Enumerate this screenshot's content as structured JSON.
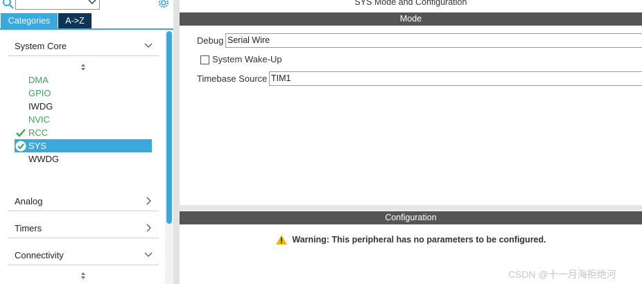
{
  "window": {
    "title": "SYS Mode and Configuration"
  },
  "left_panel": {
    "tabs": [
      {
        "label": "Categories",
        "active": true
      },
      {
        "label": "A->Z",
        "active": false
      }
    ],
    "categories": [
      {
        "label": "System Core",
        "expanded": true
      },
      {
        "label": "Analog",
        "expanded": false
      },
      {
        "label": "Timers",
        "expanded": false
      },
      {
        "label": "Connectivity",
        "expanded": true
      }
    ],
    "peripherals": [
      {
        "name": "DMA",
        "color": "#3aa655",
        "status": "none"
      },
      {
        "name": "GPIO",
        "color": "#3aa655",
        "status": "none"
      },
      {
        "name": "IWDG",
        "color": "#222222",
        "status": "none"
      },
      {
        "name": "NVIC",
        "color": "#3aa655",
        "status": "none"
      },
      {
        "name": "RCC",
        "color": "#3aa655",
        "status": "check"
      },
      {
        "name": "SYS",
        "color": "#ffffff",
        "status": "selected-check"
      },
      {
        "name": "WWDG",
        "color": "#222222",
        "status": "none"
      }
    ]
  },
  "mode": {
    "header": "Mode",
    "debug_label": "Debug",
    "debug_value": "Serial Wire",
    "wakeup_label": "System Wake-Up",
    "wakeup_checked": false,
    "timebase_label": "Timebase Source",
    "timebase_value": "TIM1"
  },
  "configuration": {
    "header": "Configuration",
    "warning": "Warning: This peripheral has no parameters to be configured."
  },
  "watermark": "CSDN @十一月海拒绝河",
  "colors": {
    "accent": "#39a8dc",
    "dark_tab": "#0f3556",
    "header_bar": "#555555",
    "green": "#3aa655",
    "warning_icon": "#f2b705"
  }
}
